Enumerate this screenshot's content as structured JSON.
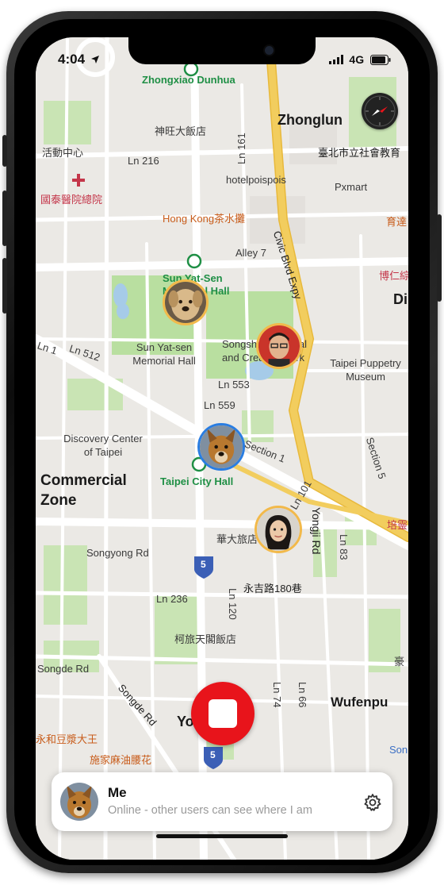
{
  "status_bar": {
    "time": "4:04",
    "network": "4G"
  },
  "map_labels": {
    "zhongxiao_dunhua": "Zhongxiao Dunhua",
    "zhonglun": "Zhonglun",
    "shenwang_hotel": "神旺大飯店",
    "ln161": "Ln 161",
    "activity_center": "活動中心",
    "ln216": "Ln 216",
    "social_edu": "臺北市立社會教育",
    "cathay_hospital": "國泰醫院總院",
    "hotelpoispois": "hotelpoispois",
    "pxmart": "Pxmart",
    "hongkong_tea": "Hong Kong茶水攤",
    "yuda": "育達",
    "alley7": "Alley 7",
    "civic_blvd": "Civic Blvd Expy",
    "sun_yat_sen_mh_station": "Sun Yat-Sen Memorial Hall",
    "boren": "博仁綜",
    "di": "Di",
    "ln1": "Ln 1",
    "ln512": "Ln 512",
    "sun_yat_sen_hall": "Sun Yat-sen Memorial Hall",
    "songshan_park": "Songshan Cultural and Creative Park",
    "puppetry": "Taipei Puppetry Museum",
    "ln553": "Ln 553",
    "ln559": "Ln 559",
    "discovery": "Discovery Center of Taipei",
    "section1": "Section 1",
    "section5": "Section 5",
    "ln101": "Ln 101",
    "commercial_zone": "Commercial Zone",
    "taipei_city_hall": "Taipei City Hall",
    "peiling": "培靈",
    "huada_hotel": "華大旅店",
    "songyong_rd": "Songyong Rd",
    "yongji_rd": "Yongji Rd",
    "ln83": "Ln 83",
    "yongji_180": "永吉路180巷",
    "ln236": "Ln 236",
    "ln120": "Ln 120",
    "kelu_hotel": "柯旅天閣飯店",
    "songde_rd": "Songde Rd",
    "songde_rd2": "Songde Rd",
    "ln74": "Ln 74",
    "ln66": "Ln 66",
    "wufenpu": "Wufenpu",
    "yo": "Yo",
    "yonghe_soy": "永和豆漿大王",
    "fried_dough": "施家麻油腰花",
    "son": "Son",
    "hao": "豪",
    "route5": "5",
    "route5b": "5"
  },
  "me_card": {
    "name": "Me",
    "status": "Online - other users can see where I am"
  },
  "icons": {
    "compass": "compass-icon",
    "settings": "gear-icon",
    "stop": "stop-icon",
    "location_arrow": "location-arrow-icon"
  },
  "colors": {
    "stop_button": "#e8141b",
    "expressway": "#f2cd5e",
    "park": "#b9dfa0",
    "water": "#a6cbe8"
  }
}
